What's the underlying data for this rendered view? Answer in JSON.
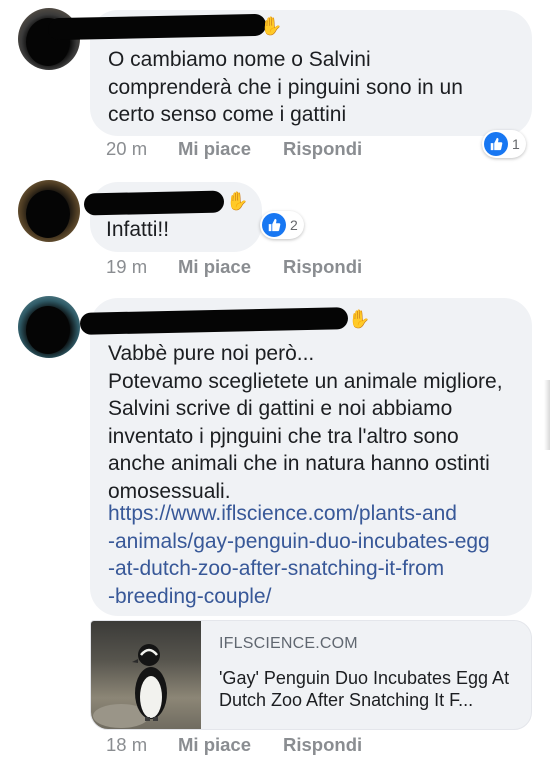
{
  "comments": [
    {
      "text": "O cambiamo nome o Salvini\ncomprenderà che i pinguini sono in un\ncerto senso come i gattini",
      "time": "20 m",
      "like_label": "Mi piace",
      "reply_label": "Rispondi",
      "reaction_count": "1"
    },
    {
      "text": "Infatti!!",
      "time": "19 m",
      "like_label": "Mi piace",
      "reply_label": "Rispondi",
      "reaction_count": "2"
    },
    {
      "text": "Vabbè pure noi però...\nPotevamo sceglietete un animale migliore,\nSalvini scrive di gattini e noi abbiamo\ninventato i pjnguini che tra l'altro sono\nanche animali che in natura hanno ostinti\nomosessuali.",
      "link": "https://www.iflscience.com/plants-and\n-animals/gay-penguin-duo-incubates-egg\n-at-dutch-zoo-after-snatching-it-from\n-breeding-couple/",
      "time": "18 m",
      "like_label": "Mi piace",
      "reply_label": "Rispondi",
      "preview": {
        "domain": "IFLSCIENCE.COM",
        "title": "'Gay' Penguin Duo Incubates Egg At Dutch Zoo After Snatching It F..."
      }
    }
  ],
  "colors": {
    "bubble": "#f0f2f5",
    "link": "#385898",
    "meta": "#8a8d91",
    "like": "#1877f2"
  },
  "icons": {
    "reaction": "like-thumb-icon",
    "hand": "waving-hand-icon"
  }
}
